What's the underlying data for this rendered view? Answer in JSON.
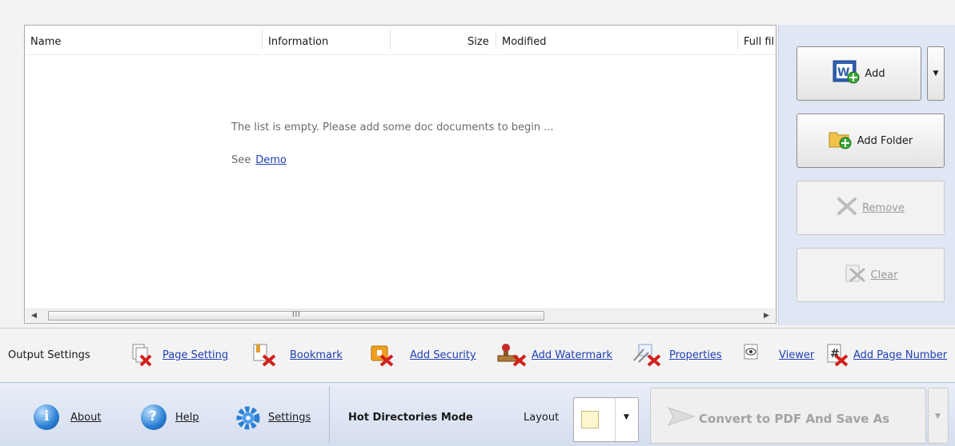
{
  "file_list": {
    "columns": [
      "Name",
      "Information",
      "Size",
      "Modified",
      "Full fil"
    ],
    "empty_message": "The list is empty. Please add some doc documents to begin ...",
    "see_label": "See",
    "demo_link": "Demo",
    "scrollbar_grip": "III"
  },
  "actions": {
    "add": "Add",
    "add_folder": "Add Folder",
    "remove": "Remove",
    "clear": "Clear"
  },
  "output_settings": {
    "label": "Output Settings",
    "items": [
      "Page Setting",
      "Bookmark",
      "Add Security",
      "Add Watermark",
      "Properties",
      "Viewer",
      "Add Page Number"
    ]
  },
  "bottom": {
    "about": "About",
    "help": "Help",
    "settings": "Settings",
    "hot_directories": "Hot Directories Mode",
    "layout": "Layout",
    "convert": "Convert to PDF And Save As"
  },
  "colors": {
    "link": "#1f3fb5",
    "panel": "#dfe6f4",
    "disabled_text": "#9a9a9a"
  }
}
